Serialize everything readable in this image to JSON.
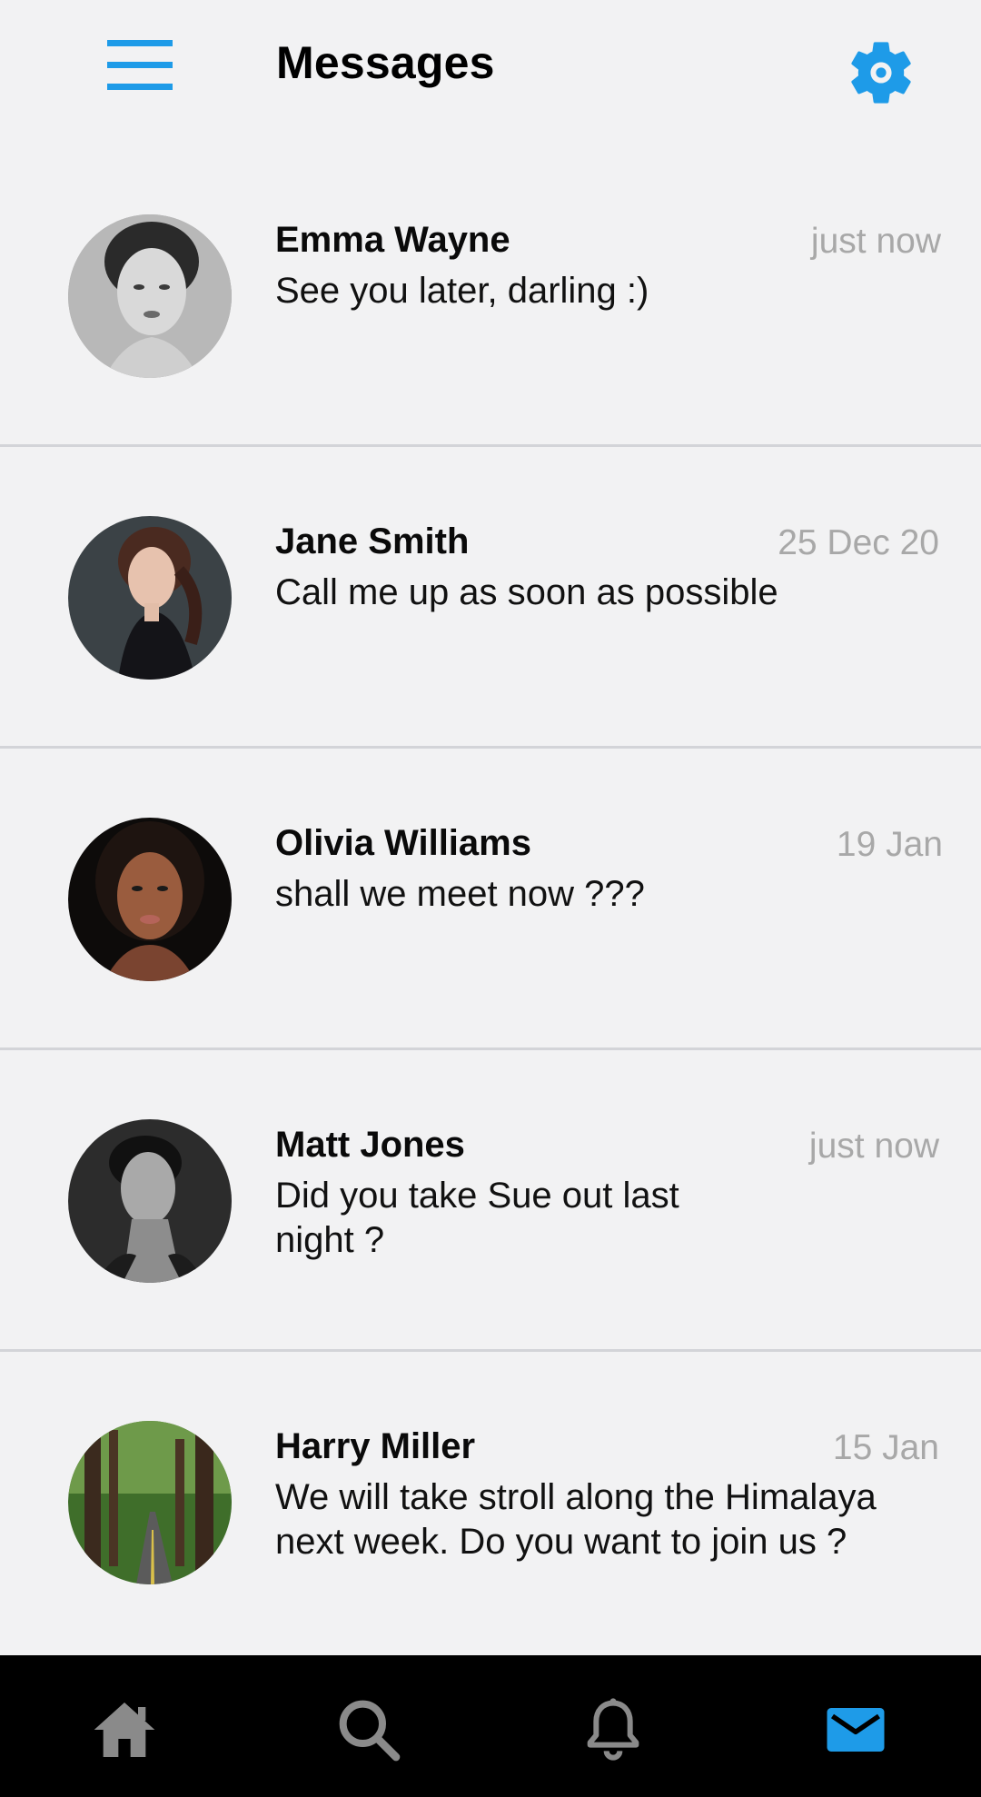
{
  "header": {
    "title": "Messages",
    "menu_icon": "hamburger-menu-icon",
    "settings_icon": "gear-icon",
    "accent_color": "#1e9be8"
  },
  "conversations": [
    {
      "name": "Emma Wayne",
      "time": "just now",
      "preview": "See you later, darling :)"
    },
    {
      "name": "Jane Smith",
      "time": "25 Dec 20",
      "preview": "Call me up as soon as possible"
    },
    {
      "name": "Olivia Williams",
      "time": "19 Jan",
      "preview": "shall we meet now ???"
    },
    {
      "name": "Matt Jones",
      "time": "just now",
      "preview": "Did you take Sue out last night ?"
    },
    {
      "name": "Harry Miller",
      "time": "15 Jan",
      "preview": "We will take stroll along the Himalaya next week. Do you want to join us ?"
    }
  ],
  "bottom_nav": {
    "items": [
      {
        "icon": "home-icon",
        "active": false
      },
      {
        "icon": "search-icon",
        "active": false
      },
      {
        "icon": "bell-icon",
        "active": false
      },
      {
        "icon": "mail-icon",
        "active": true
      }
    ],
    "active_color": "#1e9be8",
    "inactive_color": "#8a8a8a"
  }
}
